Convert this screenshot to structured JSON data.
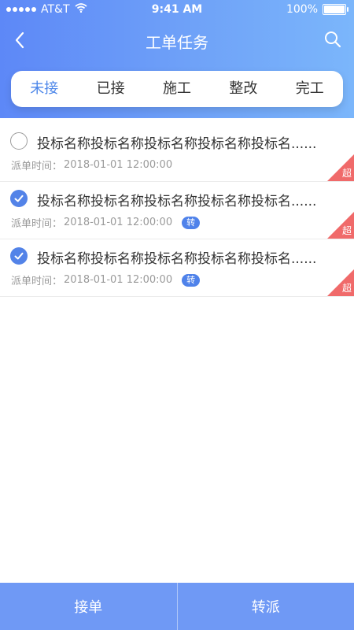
{
  "status_bar": {
    "carrier": "AT&T",
    "time": "9:41 AM",
    "battery": "100%"
  },
  "nav": {
    "title": "工单任务"
  },
  "tabs": [
    {
      "label": "未接",
      "active": true
    },
    {
      "label": "已接",
      "active": false
    },
    {
      "label": "施工",
      "active": false
    },
    {
      "label": "整改",
      "active": false
    },
    {
      "label": "完工",
      "active": false
    }
  ],
  "items": [
    {
      "title": "投标名称投标名称投标名称投标名称投标名......",
      "time_label": "派单时间：",
      "time": "2018-01-01 12:00:00",
      "checked": false,
      "transfer_badge": "",
      "overdue_badge": "超"
    },
    {
      "title": "投标名称投标名称投标名称投标名称投标名......",
      "time_label": "派单时间：",
      "time": "2018-01-01 12:00:00",
      "checked": true,
      "transfer_badge": "转",
      "overdue_badge": "超"
    },
    {
      "title": "投标名称投标名称投标名称投标名称投标名......",
      "time_label": "派单时间：",
      "time": "2018-01-01 12:00:00",
      "checked": true,
      "transfer_badge": "转",
      "overdue_badge": "超"
    }
  ],
  "bottom_bar": {
    "accept_label": "接单",
    "transfer_label": "转派"
  },
  "icons": {
    "back": "chevron-left-icon",
    "search": "search-icon",
    "wifi": "wifi-icon",
    "battery": "battery-icon",
    "check": "check-icon"
  },
  "colors": {
    "accent": "#4c86e9",
    "header_start": "#5d88f7",
    "header_end": "#7bb6fb",
    "overdue": "#f06a6a",
    "bottom_bar": "#6f99f5"
  }
}
